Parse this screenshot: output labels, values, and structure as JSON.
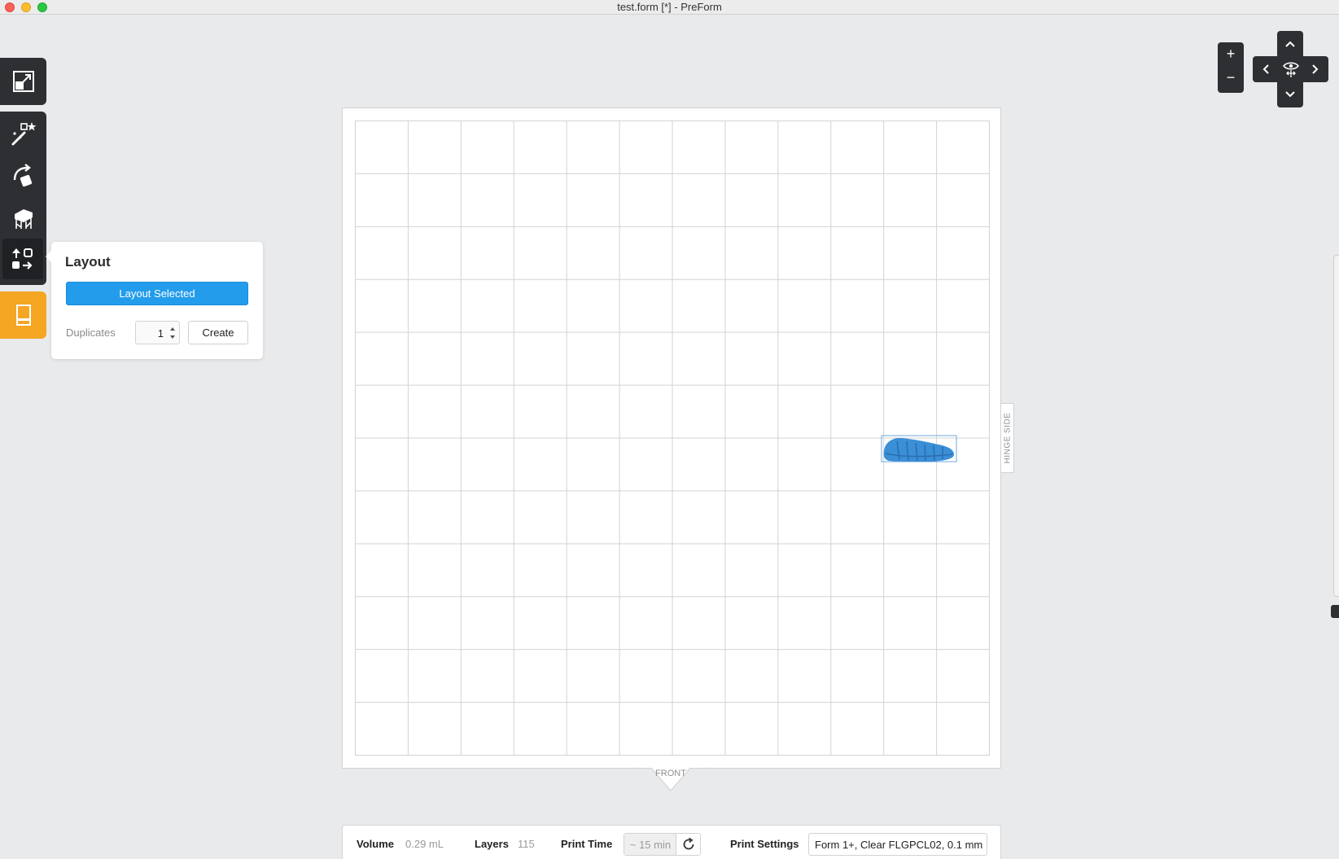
{
  "window": {
    "title": "test.form [*] - PreForm"
  },
  "toolbar": {
    "tools": [
      {
        "name": "fit-view",
        "icon": "expand-icon"
      },
      {
        "name": "one-click-print",
        "icon": "magic-wand-icon"
      },
      {
        "name": "orientation",
        "icon": "rotate-icon"
      },
      {
        "name": "supports",
        "icon": "supports-icon"
      },
      {
        "name": "layout",
        "icon": "layout-icon",
        "active": true
      },
      {
        "name": "printer",
        "icon": "printer-icon",
        "color": "#f5a623"
      }
    ]
  },
  "layout_panel": {
    "title": "Layout",
    "layout_selected_label": "Layout Selected",
    "duplicates_label": "Duplicates",
    "duplicates_value": "1",
    "create_label": "Create"
  },
  "platform": {
    "grid_columns": 12,
    "grid_rows": 12,
    "hinge_label": "HINGE SIDE",
    "front_label": "FRONT",
    "model_color": "#3a8fd6"
  },
  "view_controls": {
    "zoom_in": "+",
    "zoom_out": "−",
    "up": "^",
    "down": "v",
    "left": "<",
    "right": ">",
    "center_icon": "eye-icon"
  },
  "status": {
    "volume_label": "Volume",
    "volume_value": "0.29 mL",
    "layers_label": "Layers",
    "layers_value": "115",
    "print_time_label": "Print Time",
    "print_time_value": "~ 15 min",
    "print_settings_label": "Print Settings",
    "print_settings_value": "Form 1+, Clear FLGPCL02, 0.1 mm"
  },
  "colors": {
    "accent": "#239cec",
    "toolbar": "#2d2f33",
    "printer": "#f5a623",
    "background": "#e9eaeb"
  }
}
